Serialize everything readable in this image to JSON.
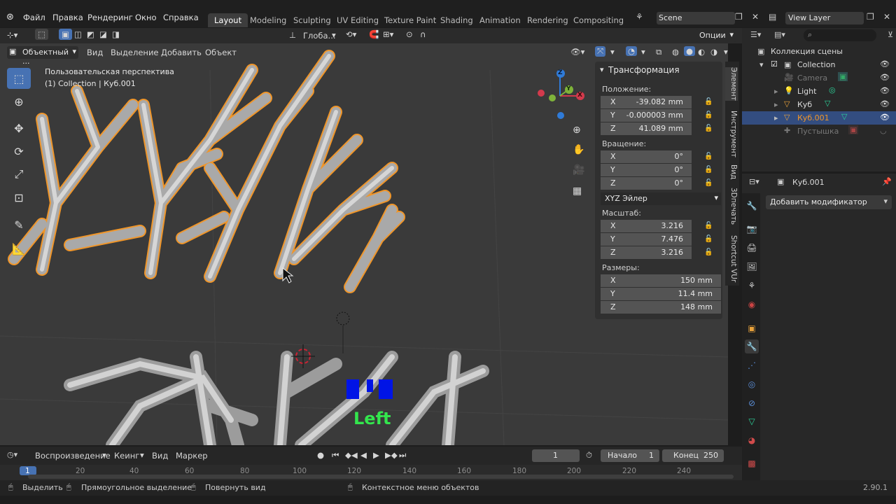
{
  "topbar": {
    "menus": [
      "Файл",
      "Правка",
      "Рендеринг",
      "Окно",
      "Справка"
    ],
    "workspaces": [
      "Layout",
      "Modeling",
      "Sculpting",
      "UV Editing",
      "Texture Paint",
      "Shading",
      "Animation",
      "Rendering",
      "Compositing"
    ],
    "active_workspace": "Layout",
    "scene": "Scene",
    "view_layer": "View Layer"
  },
  "viewport_header": {
    "transform_orientation": "Глоба...",
    "options": "Опции",
    "mode": "Объектный ...",
    "menus": [
      "Вид",
      "Выделение",
      "Добавить",
      "Объект"
    ]
  },
  "viewport": {
    "perspective_label": "Пользовательская перспектива",
    "collection_label": "(1) Collection | Куб.001",
    "overlay_text": "Left",
    "gizmo": {
      "x": "X",
      "y": "Y",
      "z": "Z"
    }
  },
  "npanel": {
    "title": "Трансформация",
    "location_label": "Положение:",
    "location": [
      {
        "axis": "X",
        "value": "-39.082 mm"
      },
      {
        "axis": "Y",
        "value": "-0.000003 mm"
      },
      {
        "axis": "Z",
        "value": "41.089 mm"
      }
    ],
    "rotation_label": "Вращение:",
    "rotation": [
      {
        "axis": "X",
        "value": "0°"
      },
      {
        "axis": "Y",
        "value": "0°"
      },
      {
        "axis": "Z",
        "value": "0°"
      }
    ],
    "rotation_mode": "XYZ Эйлер",
    "scale_label": "Масштаб:",
    "scale": [
      {
        "axis": "X",
        "value": "3.216"
      },
      {
        "axis": "Y",
        "value": "7.476"
      },
      {
        "axis": "Z",
        "value": "3.216"
      }
    ],
    "dimensions_label": "Размеры:",
    "dimensions": [
      {
        "axis": "X",
        "value": "150 mm"
      },
      {
        "axis": "Y",
        "value": "11.4 mm"
      },
      {
        "axis": "Z",
        "value": "148 mm"
      }
    ],
    "tabs": [
      "Элемент",
      "Инструмент",
      "Вид",
      "3Dпечать",
      "Shortcut VUr"
    ]
  },
  "outliner": {
    "root": "Коллекция сцены",
    "items": [
      {
        "name": "Collection",
        "level": 1
      },
      {
        "name": "Camera",
        "level": 2
      },
      {
        "name": "Light",
        "level": 2
      },
      {
        "name": "Куб",
        "level": 2
      },
      {
        "name": "Куб.001",
        "level": 2
      },
      {
        "name": "Пустышка",
        "level": 2
      }
    ]
  },
  "properties": {
    "object_name": "Куб.001",
    "add_modifier": "Добавить модификатор"
  },
  "timeline": {
    "playback": "Воспроизведение",
    "keying": "Кеинг",
    "view": "Вид",
    "marker": "Маркер",
    "current_frame": "1",
    "start_label": "Начало",
    "start": "1",
    "end_label": "Конец",
    "end": "250",
    "ticks": [
      "1",
      "20",
      "40",
      "60",
      "80",
      "100",
      "120",
      "140",
      "160",
      "180",
      "200",
      "220",
      "240"
    ]
  },
  "statusbar": {
    "select": "Выделить",
    "box_select": "Прямоугольное выделение",
    "rotate_view": "Повернуть вид",
    "context_menu": "Контекстное меню объектов",
    "version": "2.90.1"
  },
  "colors": {
    "accent": "#4772b3",
    "selection": "#f0962a",
    "active_row": "#334d80"
  }
}
